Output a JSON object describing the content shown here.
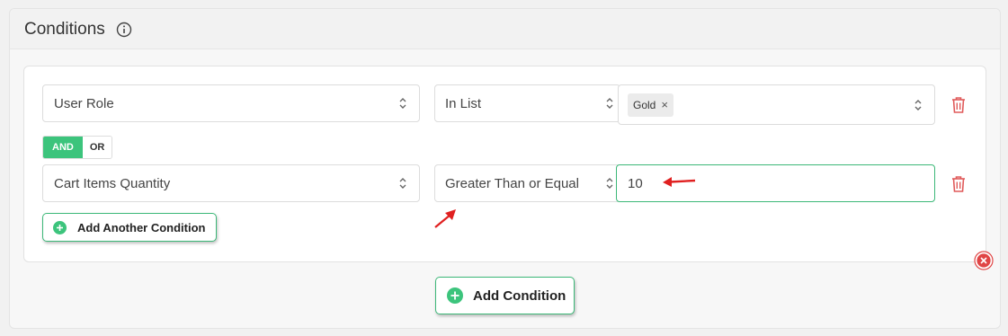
{
  "panel": {
    "title": "Conditions"
  },
  "conditions": [
    {
      "field": "User Role",
      "operator": "In List",
      "tags": [
        "Gold"
      ]
    },
    {
      "field": "Cart Items Quantity",
      "operator": "Greater Than or Equal",
      "value": "10"
    }
  ],
  "logic": {
    "and_label": "AND",
    "or_label": "OR",
    "selected": "AND"
  },
  "buttons": {
    "add_another_condition": "Add Another Condition",
    "add_condition": "Add Condition"
  },
  "colors": {
    "accent_green": "#3cc47c",
    "border_green": "#3cb878",
    "delete_red": "#e05a5a",
    "annotation_red": "#e02020"
  },
  "icons": [
    "info-icon",
    "sort-arrows-icon",
    "trash-icon",
    "plus-icon",
    "close-circle-icon",
    "tag-remove-icon"
  ]
}
